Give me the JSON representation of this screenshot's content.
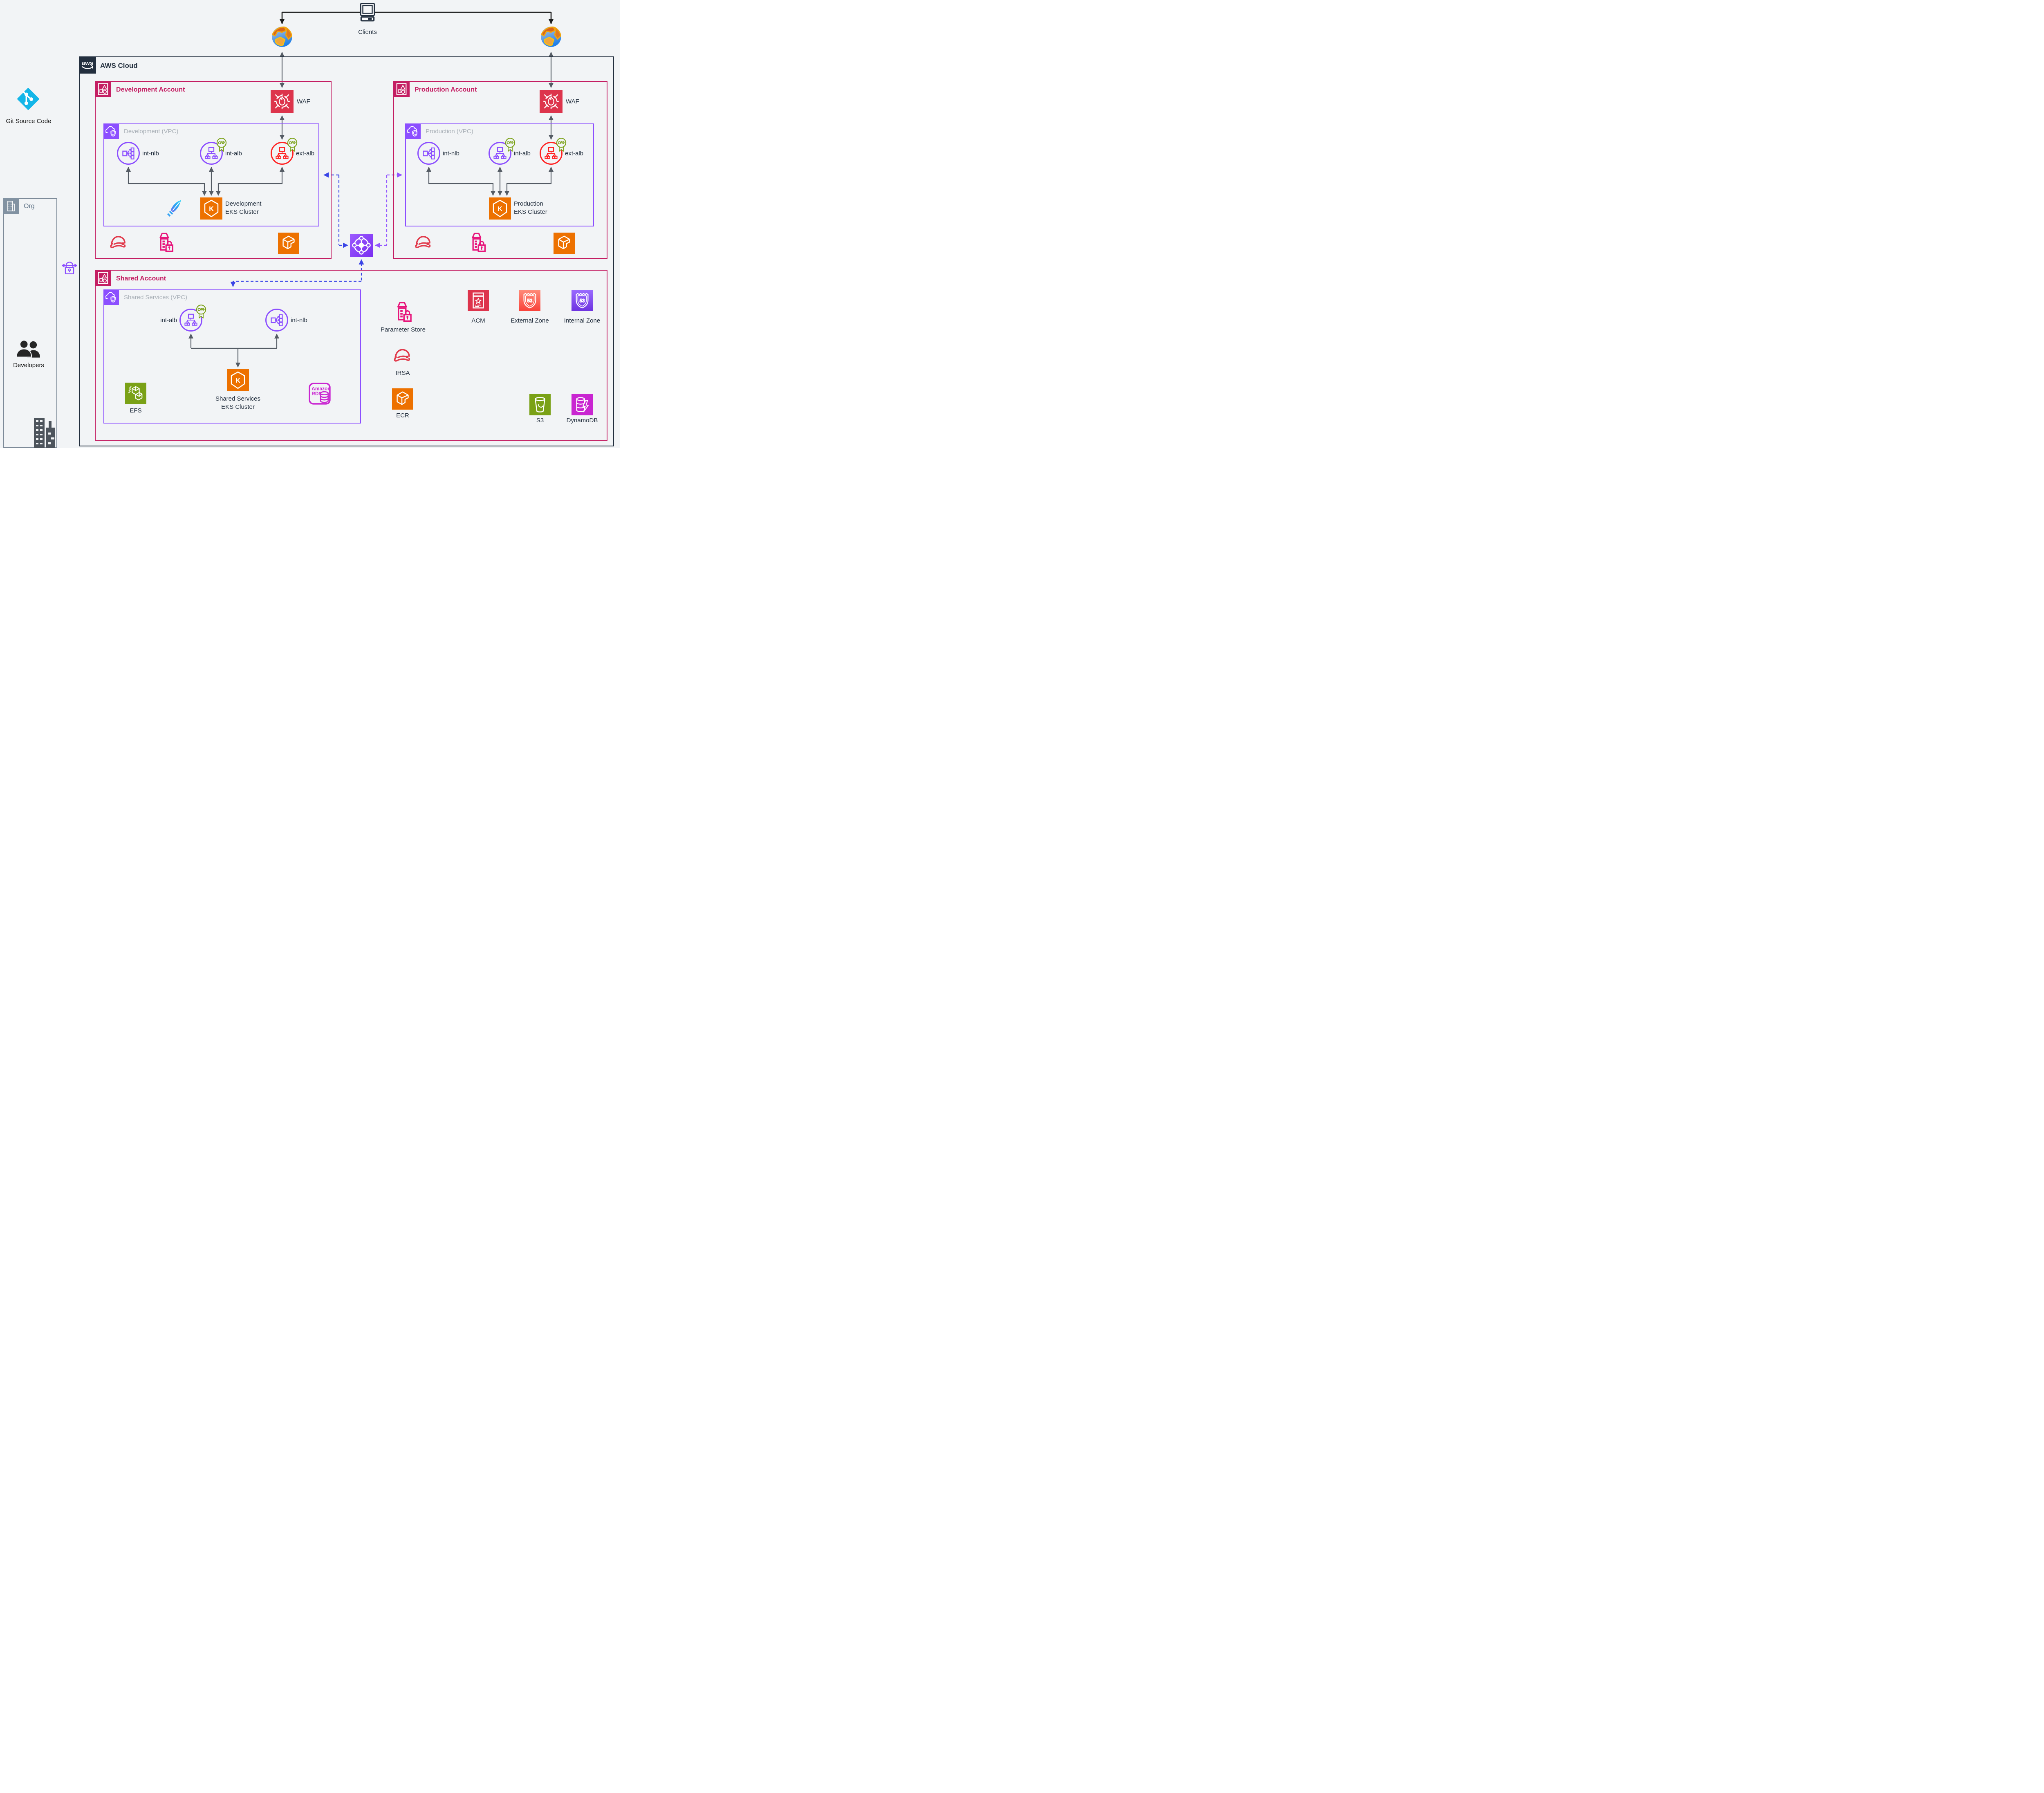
{
  "header": {
    "clients_label": "Clients",
    "aws_cloud_label": "AWS Cloud",
    "aws_logo_text": "aws"
  },
  "left_panel": {
    "git_label": "Git Source Code",
    "org_label": "Org",
    "developers_label": "Developers"
  },
  "dev_account": {
    "label": "Development Account",
    "waf_label": "WAF",
    "vpc_label": "Development (VPC)",
    "int_nlb": "int-nlb",
    "int_alb": "int-alb",
    "ext_alb": "ext-alb",
    "eks_line1": "Development",
    "eks_line2": "EKS Cluster"
  },
  "prod_account": {
    "label": "Production Account",
    "waf_label": "WAF",
    "vpc_label": "Production (VPC)",
    "int_nlb": "int-nlb",
    "int_alb": "int-alb",
    "ext_alb": "ext-alb",
    "eks_line1": "Production",
    "eks_line2": "EKS Cluster"
  },
  "shared_account": {
    "label": "Shared Account",
    "vpc_label": "Shared Services (VPC)",
    "int_alb": "int-alb",
    "int_nlb": "int-nlb",
    "eks_line1": "Shared Services",
    "eks_line2": "EKS Cluster",
    "efs_label": "EFS",
    "rds_text_line1": "Amazon",
    "rds_text_line2": "RDS",
    "parameter_store_label": "Parameter Store",
    "acm_label": "ACM",
    "external_zone_label": "External Zone",
    "internal_zone_label": "Internal Zone",
    "irsa_label": "IRSA",
    "ecr_label": "ECR",
    "s3_label": "S3",
    "dynamodb_label": "DynamoDB"
  },
  "icon_text": {
    "eks_letter": "K",
    "route53_number": "53"
  },
  "colors": {
    "account_border": "#c41e63",
    "vpc_purple": "#8c4fff",
    "security_red": "#dd344c",
    "orange": "#ed7100",
    "green": "#7aa116",
    "magenta": "#c925d1",
    "pink": "#e7157b",
    "dark": "#232f3e",
    "gray_arrow": "#545b64",
    "dashed_blue": "#3a45e6",
    "dashed_purple": "#9254ff",
    "git_cyan": "#14b6e8"
  }
}
